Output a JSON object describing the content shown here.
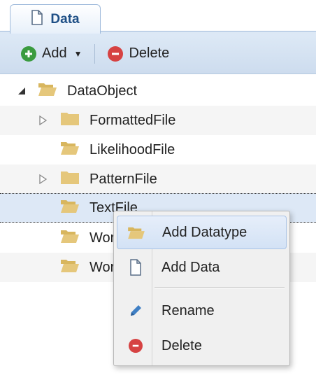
{
  "tab": {
    "label": "Data"
  },
  "toolbar": {
    "add_label": "Add",
    "delete_label": "Delete"
  },
  "tree": {
    "root": "DataObject",
    "children": [
      "FormattedFile",
      "LikelihoodFile",
      "PatternFile",
      "TextFile",
      "Wor",
      "Wor"
    ]
  },
  "context_menu": {
    "items": [
      "Add Datatype",
      "Add Data",
      "Rename",
      "Delete"
    ]
  },
  "colors": {
    "accent": "#1e4f86",
    "folder": "#e5c77b",
    "add_green": "#3a9b3f",
    "delete_red": "#d64242",
    "selection": "#dde8f6"
  }
}
